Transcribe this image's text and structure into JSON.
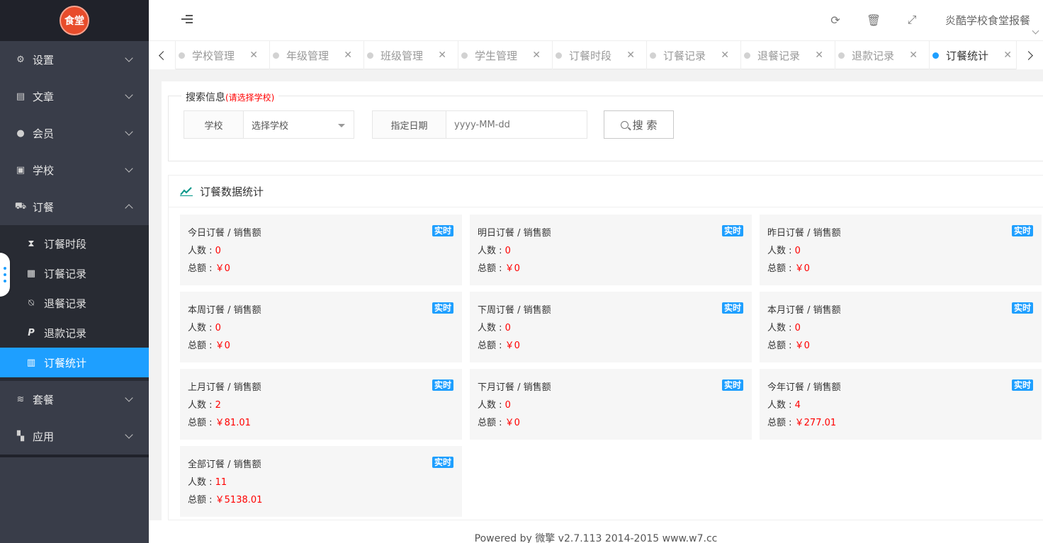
{
  "logo": {
    "text": "食堂"
  },
  "sidebar": {
    "items": [
      {
        "label": "设置",
        "icon": "gears-icon"
      },
      {
        "label": "文章",
        "icon": "newspaper-icon"
      },
      {
        "label": "会员",
        "icon": "user-icon"
      },
      {
        "label": "学校",
        "icon": "id-card-icon"
      },
      {
        "label": "订餐",
        "icon": "cart-icon"
      }
    ],
    "submenu": [
      {
        "label": "订餐时段",
        "icon": "hourglass-icon"
      },
      {
        "label": "订餐记录",
        "icon": "table-icon"
      },
      {
        "label": "退餐记录",
        "icon": "bell-slash-icon"
      },
      {
        "label": "退款记录",
        "icon": "paypal-icon"
      },
      {
        "label": "订餐统计",
        "icon": "bar-chart-icon",
        "active": true
      }
    ],
    "bottom_items": [
      {
        "label": "套餐",
        "icon": "database-icon"
      },
      {
        "label": "应用",
        "icon": "grid-icon"
      }
    ]
  },
  "header": {
    "site_name": "炎酷学校食堂报餐",
    "icons": [
      "refresh-icon",
      "trash-icon",
      "fullscreen-icon"
    ]
  },
  "tabs": [
    {
      "label": "学校管理"
    },
    {
      "label": "年级管理"
    },
    {
      "label": "班级管理"
    },
    {
      "label": "学生管理"
    },
    {
      "label": "订餐时段"
    },
    {
      "label": "订餐记录"
    },
    {
      "label": "退餐记录"
    },
    {
      "label": "退款记录"
    },
    {
      "label": "订餐统计",
      "active": true
    }
  ],
  "search": {
    "legend": "搜索信息",
    "legend_hint": "(请选择学校)",
    "school_label": "学校",
    "school_value": "选择学校",
    "date_label": "指定日期",
    "date_placeholder": "yyyy-MM-dd",
    "button_label": "搜 索"
  },
  "stats": {
    "title": "订餐数据统计",
    "count_label": "人数 : ",
    "total_label": "总额 : ",
    "badge": "实时",
    "cards": [
      {
        "title": "今日订餐 / 销售额",
        "count": "0",
        "total": "￥0"
      },
      {
        "title": "明日订餐 / 销售额",
        "count": "0",
        "total": "￥0"
      },
      {
        "title": "昨日订餐 / 销售额",
        "count": "0",
        "total": "￥0"
      },
      {
        "title": "本周订餐 / 销售额",
        "count": "0",
        "total": "￥0"
      },
      {
        "title": "下周订餐 / 销售额",
        "count": "0",
        "total": "￥0"
      },
      {
        "title": "本月订餐 / 销售额",
        "count": "0",
        "total": "￥0"
      },
      {
        "title": "上月订餐 / 销售额",
        "count": "2",
        "total": "￥81.01"
      },
      {
        "title": "下月订餐 / 销售额",
        "count": "0",
        "total": "￥0"
      },
      {
        "title": "今年订餐 / 销售额",
        "count": "4",
        "total": "￥277.01"
      },
      {
        "title": "全部订餐 / 销售额",
        "count": "11",
        "total": "￥5138.01"
      }
    ]
  },
  "footer": {
    "text": "Powered by 微擎 v2.7.113 2014-2015 www.w7.cc"
  },
  "colors": {
    "accent": "#1e9fff",
    "sidebar": "#393d49",
    "danger": "#ff0000"
  }
}
